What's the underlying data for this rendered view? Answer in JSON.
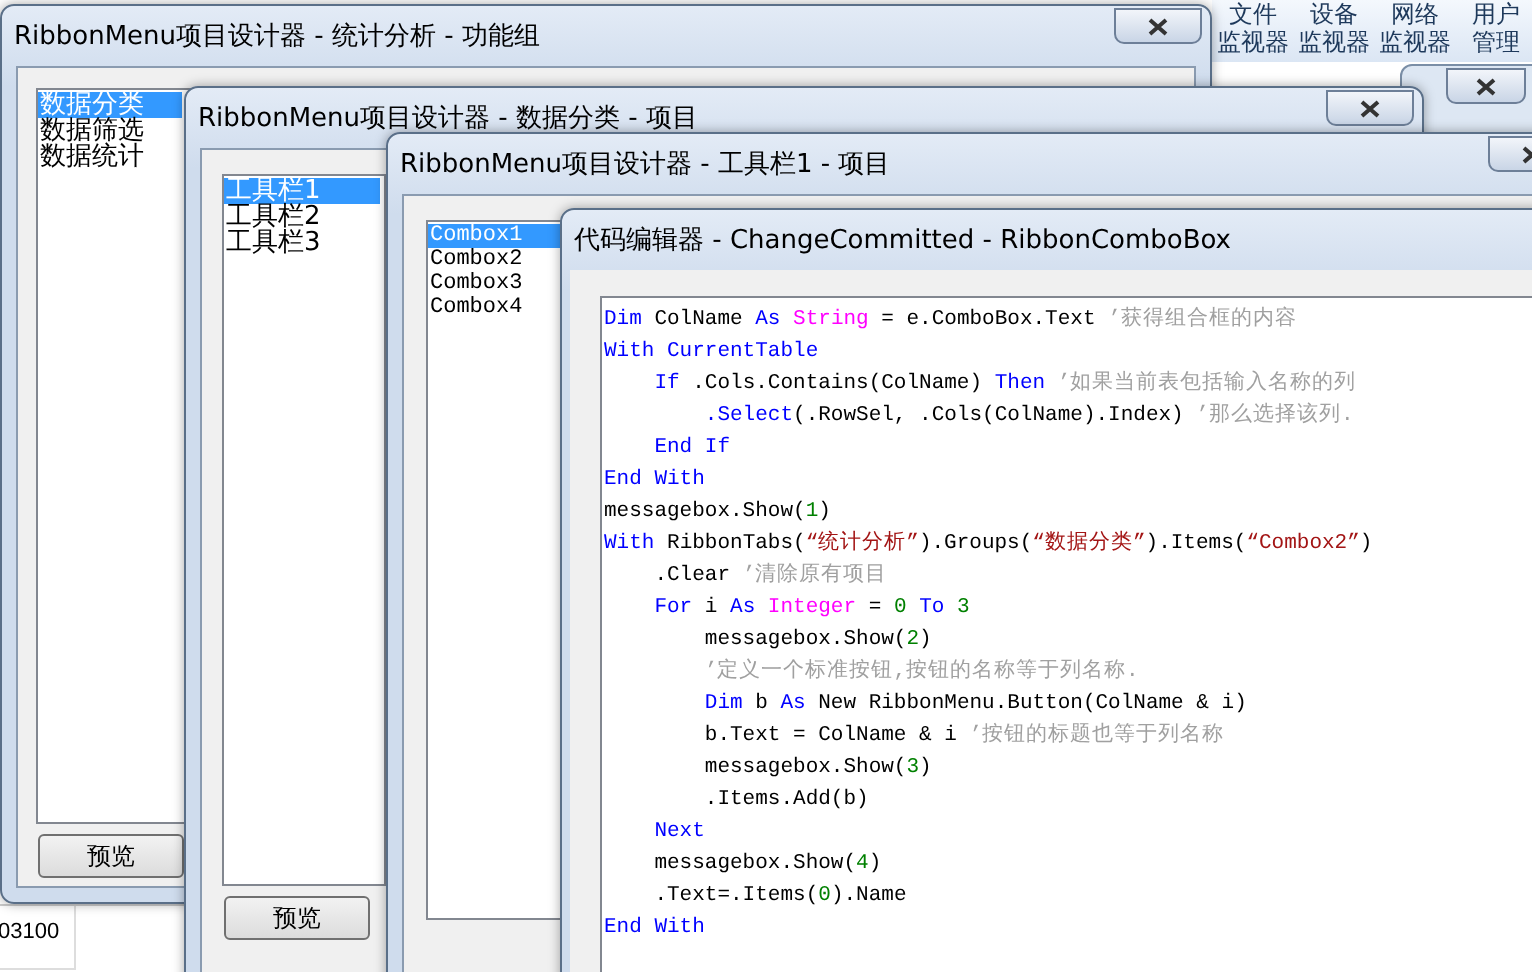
{
  "ribbon_buttons": [
    {
      "lines": [
        "文件",
        "监视器"
      ]
    },
    {
      "lines": [
        "设备",
        "监视器"
      ]
    },
    {
      "lines": [
        "网络",
        "监视器"
      ]
    },
    {
      "lines": [
        "用户",
        "管理"
      ]
    }
  ],
  "sheet_cell": "03100",
  "windows": [
    {
      "title": "RibbonMenu项目设计器 - 统计分析 - 功能组",
      "items": [
        {
          "label": "数据分类",
          "selected": true
        },
        {
          "label": "数据筛选",
          "selected": false
        },
        {
          "label": "数据统计",
          "selected": false
        }
      ],
      "button": "预览"
    },
    {
      "title": "RibbonMenu项目设计器 - 数据分类 - 项目",
      "items": [
        {
          "label": "工具栏1",
          "selected": true
        },
        {
          "label": "工具栏2",
          "selected": false
        },
        {
          "label": "工具栏3",
          "selected": false
        }
      ],
      "button": "预览"
    },
    {
      "title": "RibbonMenu项目设计器 - 工具栏1 - 项目",
      "items": [
        {
          "label": "Combox1",
          "selected": true
        },
        {
          "label": "Combox2",
          "selected": false
        },
        {
          "label": "Combox3",
          "selected": false
        },
        {
          "label": "Combox4",
          "selected": false
        }
      ]
    }
  ],
  "code_editor": {
    "title": "代码编辑器 - ChangeCommitted - RibbonComboBox",
    "lines": [
      [
        {
          "kind": "kw",
          "text": "Dim"
        },
        {
          "kind": "txt",
          "text": " ColName "
        },
        {
          "kind": "kw",
          "text": "As"
        },
        {
          "kind": "type",
          "text": " String"
        },
        {
          "kind": "txt",
          "text": " = e.ComboBox.Text "
        },
        {
          "kind": "cmt",
          "text": "’获得组合框的内容"
        }
      ],
      [
        {
          "kind": "kw",
          "text": "With CurrentTable"
        }
      ],
      [
        {
          "kind": "kw",
          "text": "    If"
        },
        {
          "kind": "txt",
          "text": " .Cols.Contains(ColName) "
        },
        {
          "kind": "kw",
          "text": "Then"
        },
        {
          "kind": "cmt",
          "text": " ’如果当前表包括输入名称的列"
        }
      ],
      [
        {
          "kind": "kw",
          "text": "        .Select"
        },
        {
          "kind": "txt",
          "text": "(.RowSel, .Cols(ColName).Index) "
        },
        {
          "kind": "cmt",
          "text": "’那么选择该列."
        }
      ],
      [
        {
          "kind": "kw",
          "text": "    End If"
        }
      ],
      [
        {
          "kind": "kw",
          "text": "End With"
        }
      ],
      [
        {
          "kind": "txt",
          "text": "messagebox.Show("
        },
        {
          "kind": "num",
          "text": "1"
        },
        {
          "kind": "txt",
          "text": ")"
        }
      ],
      [
        {
          "kind": "kw",
          "text": "With"
        },
        {
          "kind": "txt",
          "text": " RibbonTabs("
        },
        {
          "kind": "str",
          "text": "“统计分析”"
        },
        {
          "kind": "txt",
          "text": ").Groups("
        },
        {
          "kind": "str",
          "text": "“数据分类”"
        },
        {
          "kind": "txt",
          "text": ").Items("
        },
        {
          "kind": "str",
          "text": "“Combox2”"
        },
        {
          "kind": "txt",
          "text": ")"
        }
      ],
      [
        {
          "kind": "txt",
          "text": "    .Clear "
        },
        {
          "kind": "cmt",
          "text": "’清除原有项目"
        }
      ],
      [
        {
          "kind": "kw",
          "text": "    For"
        },
        {
          "kind": "txt",
          "text": " i "
        },
        {
          "kind": "kw",
          "text": "As"
        },
        {
          "kind": "type",
          "text": " Integer"
        },
        {
          "kind": "txt",
          "text": " = "
        },
        {
          "kind": "num",
          "text": "0"
        },
        {
          "kind": "kw",
          "text": " To"
        },
        {
          "kind": "num",
          "text": " 3"
        }
      ],
      [
        {
          "kind": "txt",
          "text": "        messagebox.Show("
        },
        {
          "kind": "num",
          "text": "2"
        },
        {
          "kind": "txt",
          "text": ")"
        }
      ],
      [
        {
          "kind": "cmt",
          "text": "        ’定义一个标准按钮,按钮的名称等于列名称."
        }
      ],
      [
        {
          "kind": "kw",
          "text": "        Dim"
        },
        {
          "kind": "txt",
          "text": " b "
        },
        {
          "kind": "kw",
          "text": "As"
        },
        {
          "kind": "txt",
          "text": " New RibbonMenu.Button(ColName & i)"
        }
      ],
      [
        {
          "kind": "txt",
          "text": "        b.Text = ColName & i "
        },
        {
          "kind": "cmt",
          "text": "’按钮的标题也等于列名称"
        }
      ],
      [
        {
          "kind": "txt",
          "text": "        messagebox.Show("
        },
        {
          "kind": "num",
          "text": "3"
        },
        {
          "kind": "txt",
          "text": ")"
        }
      ],
      [
        {
          "kind": "txt",
          "text": "        .Items.Add(b)"
        }
      ],
      [
        {
          "kind": "kw",
          "text": "    Next"
        }
      ],
      [
        {
          "kind": "txt",
          "text": "    messagebox.Show("
        },
        {
          "kind": "num",
          "text": "4"
        },
        {
          "kind": "txt",
          "text": ")"
        }
      ],
      [
        {
          "kind": "txt",
          "text": "    .Text=.Items("
        },
        {
          "kind": "num",
          "text": "0"
        },
        {
          "kind": "txt",
          "text": ").Name"
        }
      ],
      [
        {
          "kind": "kw",
          "text": "End With"
        }
      ]
    ]
  }
}
